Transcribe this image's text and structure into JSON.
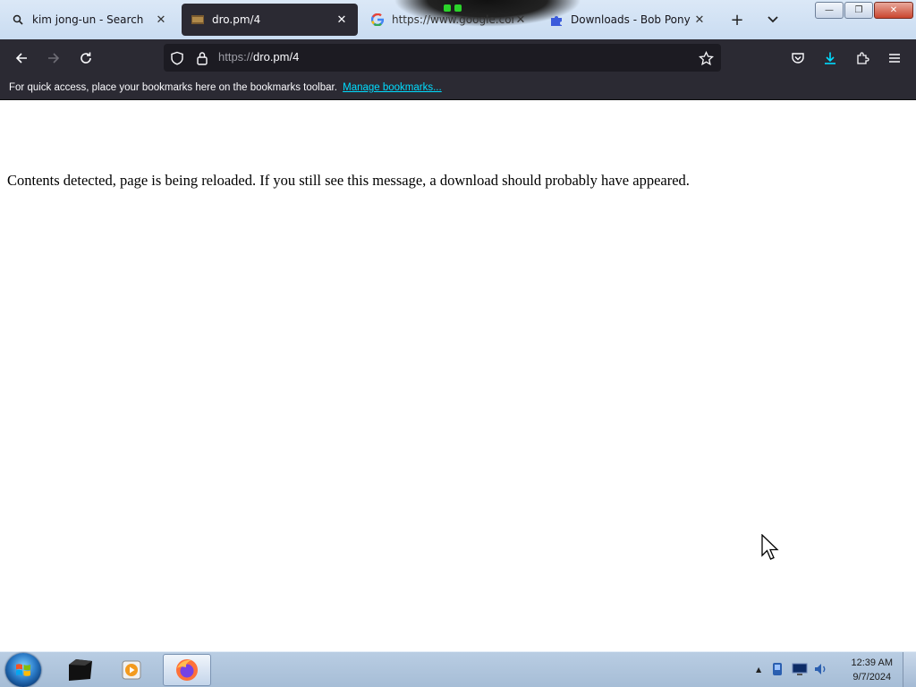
{
  "browser": {
    "tabs": [
      {
        "label": "kim jong-un - Search",
        "favicon": "search-icon",
        "active": false
      },
      {
        "label": "dro.pm/4",
        "favicon": "page-icon",
        "active": true
      },
      {
        "label": "https://www.google.com",
        "favicon": "google-icon",
        "active": false
      },
      {
        "label": "Downloads - Bob Pony",
        "favicon": "puzzle-icon",
        "active": false
      }
    ],
    "new_tab": "+",
    "tab_list": "⌄"
  },
  "window_controls": {
    "minimize": "—",
    "restore": "❐",
    "close": "✕"
  },
  "navigation": {
    "url_scheme": "https://",
    "url_rest": "dro.pm/4"
  },
  "bookmarks_bar": {
    "message": "For quick access, place your bookmarks here on the bookmarks toolbar.",
    "manage_link": "Manage bookmarks..."
  },
  "page": {
    "message": "Contents detected, page is being reloaded. If you still see this message, a download should probably have appeared."
  },
  "taskbar": {
    "time": "12:39 AM",
    "date": "9/7/2024",
    "tray_arrow": "▲"
  },
  "colors": {
    "toolbar_bg": "#2b2a33",
    "urlbar_bg": "#1c1b22",
    "link": "#00ddff",
    "download_accent": "#00ddff"
  }
}
